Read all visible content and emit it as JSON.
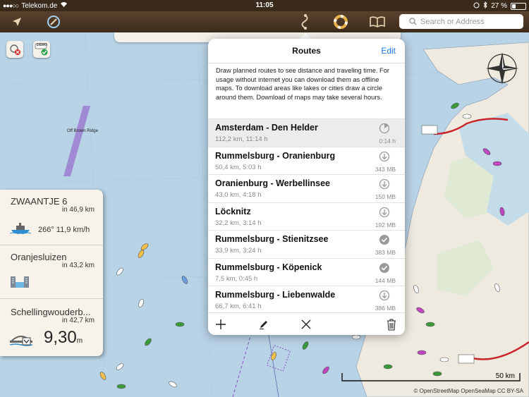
{
  "status_bar": {
    "carrier": "Telekom.de",
    "time": "11:05",
    "battery": "27 %",
    "battery_level": 0.27
  },
  "toolbar": {
    "icons": [
      "location-arrow-icon",
      "compass-satellite-icon",
      "route-icon",
      "lifebuoy-icon",
      "book-icon"
    ],
    "search_placeholder": "Search or Address"
  },
  "map": {
    "labels": {
      "ridge": "Off Brown Ridge"
    },
    "badges": {
      "demo": "DEMO"
    },
    "scale_label": "50 km",
    "copyright": "© OpenStreetMap OpenSeaMap CC BY-SA"
  },
  "left_panel": {
    "items": [
      {
        "title": "ZWAANTJE 6",
        "distance": "in 46,9 km",
        "speed": "266° 11,9 km/h",
        "icon": "ship-icon"
      },
      {
        "title": "Oranjesluizen",
        "distance": "in 43,2 km",
        "icon": "lock-gate-icon"
      },
      {
        "title": "Schellingwouderb...",
        "distance": "in 42,7 km",
        "value": "9,30",
        "unit": "m",
        "icon": "bridge-icon"
      }
    ]
  },
  "routes_popover": {
    "title": "Routes",
    "edit_label": "Edit",
    "description": "Draw planned routes to see distance and traveling time. For usage without internet you can download them as offline maps. To download areas like lakes or cities draw a circle around them. Download of maps may take several hours.",
    "routes": [
      {
        "name": "Amsterdam - Den Helder",
        "info": "112,2 km, 11:14 h",
        "status": "progress",
        "meta": "0:14 h",
        "selected": true
      },
      {
        "name": "Rummelsburg - Oranienburg",
        "info": "50,4 km, 5:03 h",
        "status": "download",
        "meta": "343 MB"
      },
      {
        "name": "Oranienburg - Werbellinsee",
        "info": "43,0 km, 4:18 h",
        "status": "download",
        "meta": "150 MB"
      },
      {
        "name": "Löcknitz",
        "info": "32,2 km, 3:14 h",
        "status": "download",
        "meta": "192 MB"
      },
      {
        "name": "Rummelsburg - Stienitzsee",
        "info": "33,9 km, 3:24 h",
        "status": "done",
        "meta": "383 MB"
      },
      {
        "name": "Rummelsburg - Köpenick",
        "info": "7,5 km, 0:45 h",
        "status": "done",
        "meta": "144 MB"
      },
      {
        "name": "Rummelsburg - Liebenwalde",
        "info": "66,7 km, 6:41 h",
        "status": "download",
        "meta": "386 MB"
      }
    ],
    "footer": [
      "add-icon",
      "pencil-icon",
      "close-icon",
      "trash-icon"
    ]
  },
  "colors": {
    "sea": "#b9d3e6",
    "land": "#eeeae0",
    "toolbar": "#4a3624",
    "accent": "#1a7ae8",
    "route_red": "#c9252b",
    "traffic_purple": "#8a4fc3"
  }
}
